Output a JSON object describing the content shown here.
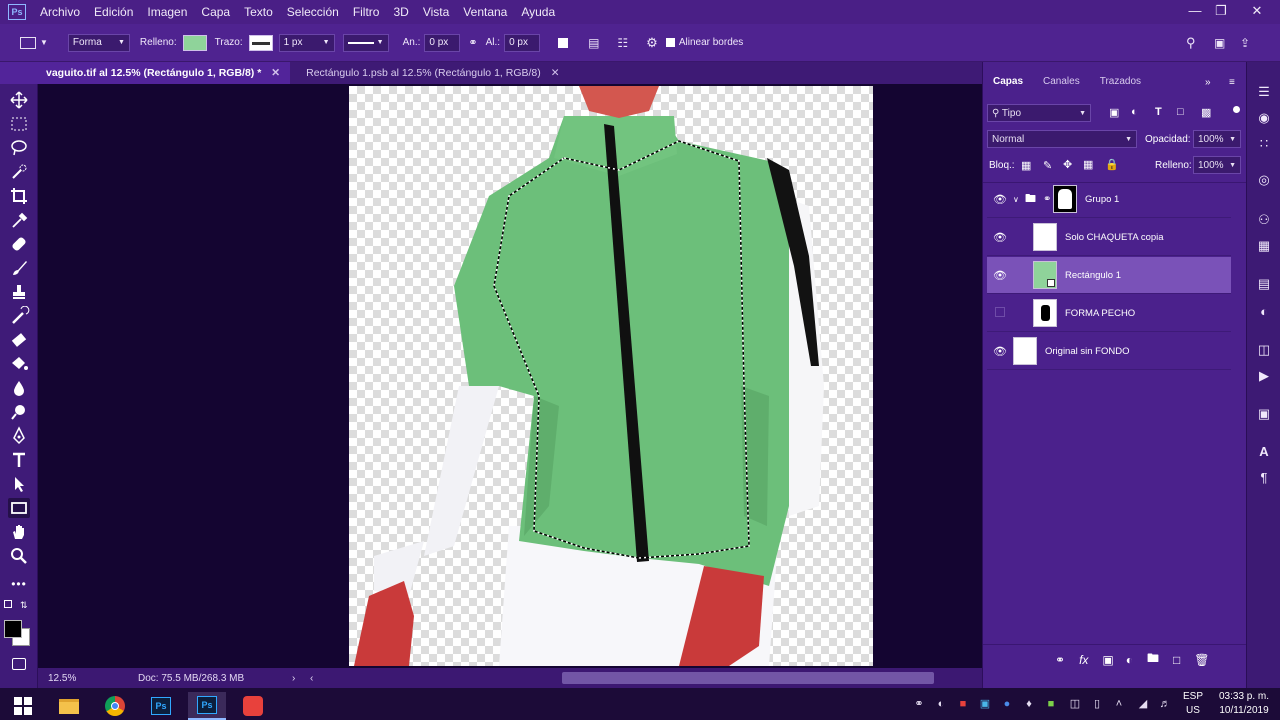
{
  "menu": {
    "items": [
      "Archivo",
      "Edición",
      "Imagen",
      "Capa",
      "Texto",
      "Selección",
      "Filtro",
      "3D",
      "Vista",
      "Ventana",
      "Ayuda"
    ]
  },
  "options": {
    "mode": "Forma",
    "fill_label": "Relleno:",
    "fill_color": "#8fd39a",
    "stroke_label": "Trazo:",
    "stroke_width": "1 px",
    "width_label": "An.:",
    "width_value": "0 px",
    "height_label": "Al.:",
    "height_value": "0 px",
    "align_edges": "Alinear bordes"
  },
  "tabs": [
    {
      "label": "vaguito.tif al 12.5% (Rectángulo 1, RGB/8) *",
      "active": true
    },
    {
      "label": "Rectángulo 1.psb al 12.5% (Rectángulo 1, RGB/8)",
      "active": false
    }
  ],
  "status": {
    "zoom": "12.5%",
    "doc": "Doc: 75.5 MB/268.3 MB"
  },
  "panel": {
    "tabs": [
      "Capas",
      "Canales",
      "Trazados"
    ],
    "filter": "Tipo",
    "blend_mode": "Normal",
    "opacity_label": "Opacidad:",
    "opacity_value": "100%",
    "lock_label": "Bloq.:",
    "fill_label": "Relleno:",
    "fill_value": "100%",
    "layers": [
      {
        "name": "Grupo 1",
        "visible": true,
        "type": "group"
      },
      {
        "name": "Solo CHAQUETA copia",
        "visible": true,
        "type": "layer"
      },
      {
        "name": "Rectángulo 1",
        "visible": true,
        "type": "shape",
        "selected": true
      },
      {
        "name": "FORMA PECHO",
        "visible": false,
        "type": "layer"
      },
      {
        "name": "Original sin FONDO",
        "visible": true,
        "type": "layer"
      }
    ]
  },
  "taskbar": {
    "language": "ESP",
    "region": "US",
    "time": "03:33 p. m.",
    "date": "10/11/2019"
  },
  "colors": {
    "accent": "#4a1f86",
    "jacket": "#6cbf7a",
    "selected_layer": "#7a52b8"
  }
}
